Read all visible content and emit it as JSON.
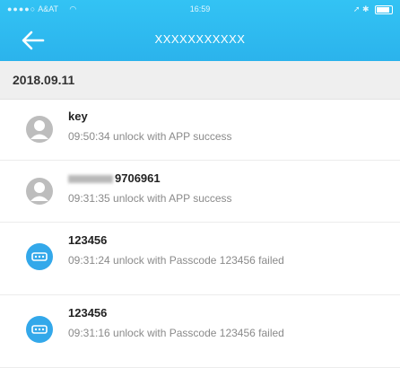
{
  "status_bar": {
    "carrier": "A&AT",
    "time": "16:59"
  },
  "header": {
    "title": "XXXXXXXXXXX",
    "accent_color": "#2bb3ec"
  },
  "date_section": "2018.09.11",
  "records": [
    {
      "name": "key",
      "detail": "09:50:34 unlock with APP success",
      "icon": "user-silhouette-icon"
    },
    {
      "name": "9706961",
      "detail": "09:31:35 unlock with APP success",
      "icon": "user-silhouette-icon"
    },
    {
      "name": "123456",
      "detail": "09:31:24 unlock with Passcode 123456 failed",
      "icon": "passcode-icon"
    },
    {
      "name": "123456",
      "detail": "09:31:16 unlock with Passcode 123456 failed",
      "icon": "passcode-icon"
    }
  ]
}
